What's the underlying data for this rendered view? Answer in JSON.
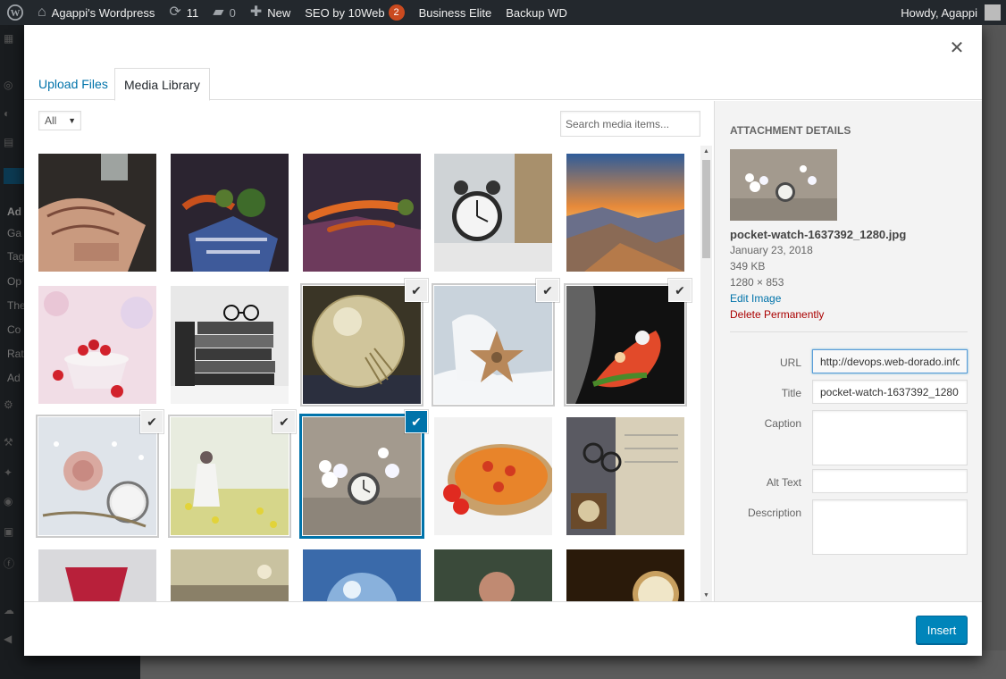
{
  "admin_bar": {
    "site_name": "Agappi's Wordpress",
    "updates_count": "11",
    "comments_count": "0",
    "new_label": "New",
    "seo_label": "SEO by 10Web",
    "seo_badge": "2",
    "business_label": "Business Elite",
    "backup_label": "Backup WD",
    "greeting": "Howdy, Agappi"
  },
  "admin_menu": {
    "items": [
      "Ad",
      "Ga",
      "Tag",
      "Op",
      "The",
      "Co",
      "Rat",
      "Ad"
    ]
  },
  "modal": {
    "tabs": [
      {
        "label": "Upload Files",
        "active": false
      },
      {
        "label": "Media Library",
        "active": true
      }
    ],
    "filter": {
      "value": "All"
    },
    "search": {
      "placeholder": "Search media items..."
    }
  },
  "attachment": {
    "heading": "Attachment Details",
    "filename": "pocket-watch-1637392_1280.jpg",
    "date": "January 23, 2018",
    "size": "349 KB",
    "dimensions": "1280 × 853",
    "edit_link": "Edit Image",
    "delete_link": "Delete Permanently",
    "fields": {
      "url_label": "URL",
      "url_value": "http://devops.web-dorado.info",
      "title_label": "Title",
      "title_value": "pocket-watch-1637392_1280",
      "caption_label": "Caption",
      "caption_value": "",
      "alt_label": "Alt Text",
      "alt_value": "",
      "description_label": "Description",
      "description_value": ""
    }
  },
  "footer": {
    "insert_label": "Insert"
  },
  "colors": {
    "accent": "#0073aa",
    "button": "#0085ba",
    "delete": "#a00000"
  }
}
